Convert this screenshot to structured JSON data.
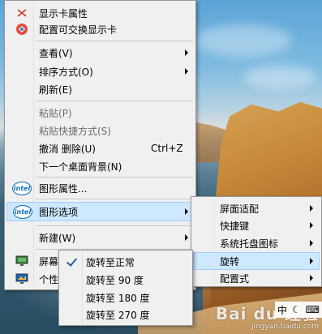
{
  "main_menu": {
    "items": [
      {
        "label": "显示卡属性",
        "icon": "display-properties-icon",
        "disabled": false
      },
      {
        "label": "配置可交换显示卡",
        "icon": "switchable-graphics-icon",
        "disabled": false
      },
      {
        "label": "查看(V)",
        "submenu": true,
        "disabled": false
      },
      {
        "label": "排序方式(O)",
        "submenu": true,
        "disabled": false
      },
      {
        "label": "刷新(E)",
        "disabled": false
      },
      {
        "label": "粘贴(P)",
        "disabled": true
      },
      {
        "label": "粘贴快捷方式(S)",
        "disabled": true
      },
      {
        "label": "撤消 删除(U)",
        "shortcut": "Ctrl+Z",
        "disabled": false
      },
      {
        "label": "下一个桌面背景(N)",
        "disabled": false
      },
      {
        "label": "图形属性...",
        "icon": "intel-icon",
        "disabled": false
      },
      {
        "label": "图形选项",
        "icon": "intel-icon",
        "submenu": true,
        "highlighted": true,
        "disabled": false
      },
      {
        "label": "新建(W)",
        "submenu": true,
        "disabled": false
      },
      {
        "label": "屏幕",
        "icon": "screen-resolution-icon",
        "disabled": false
      },
      {
        "label": "个性",
        "icon": "personalize-icon",
        "disabled": false
      }
    ]
  },
  "graphics_options_submenu": {
    "items": [
      {
        "label": "屏面适配",
        "submenu": true
      },
      {
        "label": "快捷键",
        "submenu": true
      },
      {
        "label": "系统托盘图标",
        "submenu": true
      },
      {
        "label": "旋转",
        "submenu": true,
        "highlighted": true
      },
      {
        "label": "配置式",
        "submenu": true
      }
    ]
  },
  "rotation_submenu": {
    "items": [
      {
        "label": "旋转至正常",
        "checked": true
      },
      {
        "label": "旋转至 90 度",
        "checked": false
      },
      {
        "label": "旋转至 180 度",
        "checked": false
      },
      {
        "label": "旋转至 270 度",
        "checked": false
      }
    ]
  },
  "icons": {
    "intel_text": "intel"
  },
  "tray": {
    "ime": "中",
    "moon": "☾",
    "keyboard": "⌨"
  },
  "watermark": {
    "logo": "Bai du 经验",
    "url": "jingyan.baidu.com"
  },
  "colors": {
    "menu_bg": "#f0f0f0",
    "highlight_bg": "#cde8ff",
    "highlight_border": "#9ed0fb",
    "disabled_text": "#6d6d6d",
    "intel_blue": "#0f6fc0"
  }
}
